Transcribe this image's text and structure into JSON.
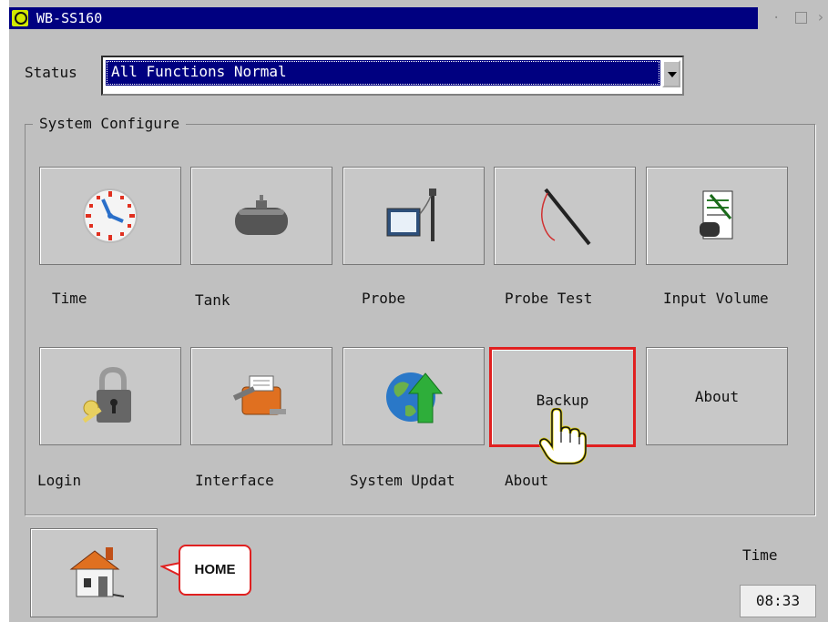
{
  "window": {
    "title": "WB-SS160"
  },
  "status": {
    "label": "Status",
    "value": "All Functions Normal"
  },
  "group": {
    "title": "System Configure"
  },
  "tiles": [
    {
      "label": "Time",
      "icon": "clock-icon"
    },
    {
      "label": "Tank",
      "icon": "tank-icon"
    },
    {
      "label": "Probe",
      "icon": "probe-icon"
    },
    {
      "label": "Probe Test",
      "icon": "probe-test-icon"
    },
    {
      "label": "Input Volume",
      "icon": "input-volume-icon"
    },
    {
      "label": "Login",
      "icon": "padlock-key-icon"
    },
    {
      "label": "Interface",
      "icon": "printer-tools-icon"
    },
    {
      "label": "System Updat",
      "icon": "globe-update-icon"
    },
    {
      "label": "About",
      "button_text": "Backup",
      "highlighted": true
    },
    {
      "label": "",
      "button_text": "About"
    }
  ],
  "home": {
    "callout": "HOME",
    "icon": "house-icon"
  },
  "clock": {
    "label": "Time",
    "value": "08:33"
  },
  "colors": {
    "titlebar": "#000080",
    "highlight": "#e02020",
    "panel": "#c0c0c0"
  }
}
